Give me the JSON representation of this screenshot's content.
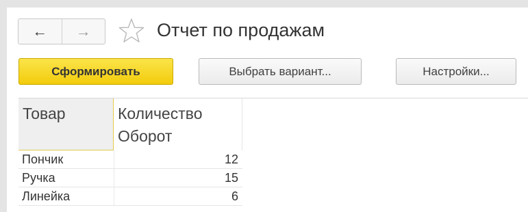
{
  "window": {
    "title": "Отчет по продажам"
  },
  "navigation": {
    "back_icon": "arrow-left-icon",
    "forward_icon": "arrow-right-icon",
    "favorite_icon": "star-outline-icon"
  },
  "toolbar": {
    "generate_label": "Сформировать",
    "choose_variant_label": "Выбрать вариант...",
    "settings_label": "Настройки..."
  },
  "report": {
    "headers": {
      "item": "Товар",
      "quantity": "Количество",
      "turnover": "Оборот"
    },
    "rows": [
      {
        "name": "Пончик",
        "qty": "12"
      },
      {
        "name": "Ручка",
        "qty": "15"
      },
      {
        "name": "Линейка",
        "qty": "6"
      }
    ]
  },
  "colors": {
    "primary_button": "#f5d41a",
    "header_accent_border": "#e3c94e",
    "window_frame": "#e4e4e4"
  }
}
